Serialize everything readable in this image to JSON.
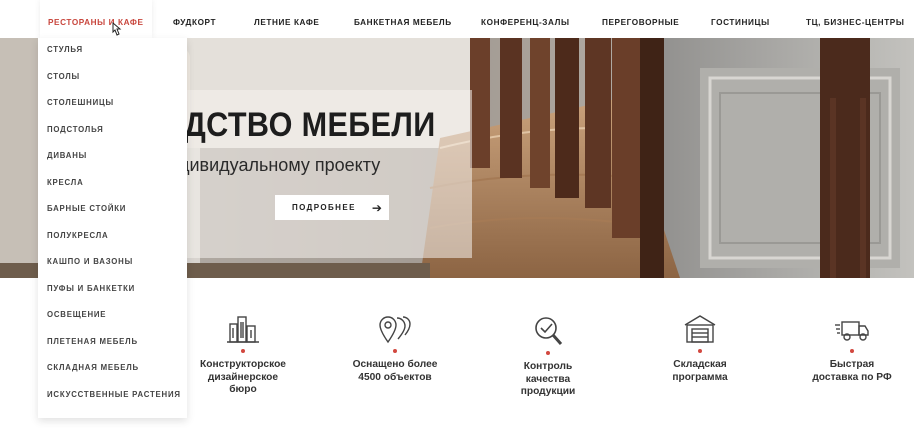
{
  "nav": {
    "items": [
      {
        "label": "РЕСТОРАНЫ И КАФЕ",
        "active": true
      },
      {
        "label": "ФУДКОРТ"
      },
      {
        "label": "ЛЕТНИЕ КАФЕ"
      },
      {
        "label": "БАНКЕТНАЯ МЕБЕЛЬ"
      },
      {
        "label": "КОНФЕРЕНЦ-ЗАЛЫ"
      },
      {
        "label": "ПЕРЕГОВОРНЫЕ"
      },
      {
        "label": "ГОСТИНИЦЫ"
      },
      {
        "label": "ТЦ, БИЗНЕС-ЦЕНТРЫ"
      }
    ]
  },
  "dropdown": {
    "items": [
      "СТУЛЬЯ",
      "СТОЛЫ",
      "СТОЛЕШНИЦЫ",
      "ПОДСТОЛЬЯ",
      "ДИВАНЫ",
      "КРЕСЛА",
      "БАРНЫЕ СТОЙКИ",
      "ПОЛУКРЕСЛА",
      "КАШПО И ВАЗОНЫ",
      "ПУФЫ И БАНКЕТКИ",
      "ОСВЕЩЕНИЕ",
      "ПЛЕТЕНАЯ МЕБЕЛЬ",
      "СКЛАДНАЯ МЕБЕЛЬ",
      "ИСКУССТВЕННЫЕ РАСТЕНИЯ"
    ]
  },
  "hero": {
    "title": "ДСТВО МЕБЕЛИ",
    "subtitle": "дивидуальному проекту",
    "button_label": "ПОДРОБНЕЕ",
    "button_arrow": "➔"
  },
  "features": [
    {
      "icon": "buildings-icon",
      "line1": "Конструкторское",
      "line2": "дизайнерское",
      "line3": "бюро"
    },
    {
      "icon": "map-pins-icon",
      "line1": "Оснащено более",
      "line2": "4500 объектов",
      "line3": ""
    },
    {
      "icon": "quality-check-icon",
      "line1": "Контроль",
      "line2": "качества",
      "line3": "продукции"
    },
    {
      "icon": "warehouse-icon",
      "line1": "Складская",
      "line2": "программа",
      "line3": ""
    },
    {
      "icon": "delivery-truck-icon",
      "line1": "Быстрая",
      "line2": "доставка по РФ",
      "line3": ""
    }
  ],
  "colors": {
    "accent": "#c8463d",
    "text": "#222222",
    "hero_bg": "#7a6a5c"
  }
}
